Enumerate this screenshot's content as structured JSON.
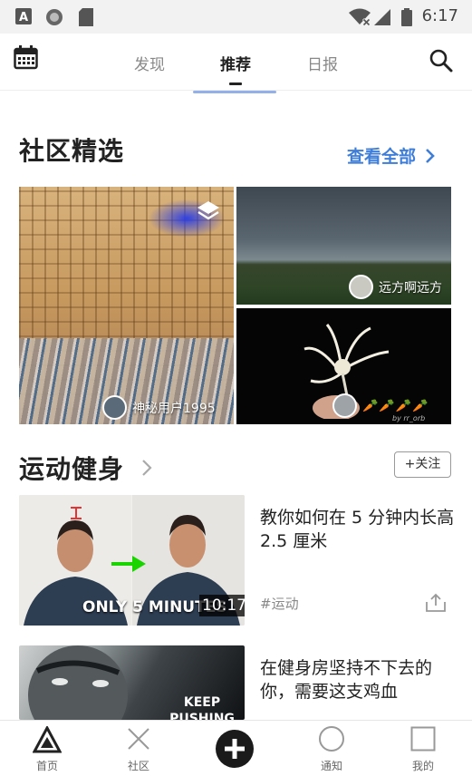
{
  "status_bar": {
    "time": "6:17",
    "icons": [
      "a-notification-icon",
      "circle-notification-icon",
      "sd-card-icon",
      "wifi-off-icon",
      "signal-icon",
      "battery-icon"
    ]
  },
  "top_nav": {
    "tabs": [
      {
        "label": "发现",
        "active": false
      },
      {
        "label": "推荐",
        "active": true
      },
      {
        "label": "日报",
        "active": false
      }
    ],
    "icons": [
      "calendar-icon",
      "search-icon"
    ]
  },
  "community": {
    "title": "社区精选",
    "see_all": "查看全部",
    "cards": [
      {
        "user": "神秘用户1995",
        "icon": "layers-icon"
      },
      {
        "user": "远方啊远方"
      },
      {
        "user": "",
        "watermark": "by rr_orb"
      }
    ]
  },
  "fitness": {
    "title": "运动健身",
    "follow": "+关注",
    "articles": [
      {
        "title": "教你如何在 5 分钟内长高 2.5 厘米",
        "tag": "#运动",
        "thumb_caption": "ONLY 5 MINUTES",
        "duration": "10:17"
      },
      {
        "title": "在健身房坚持不下去的你，需要这支鸡血",
        "thumb_caption": "KEEP PUSHING"
      }
    ]
  },
  "bottom_nav": {
    "items": [
      {
        "label": "首页",
        "icon": "home-triangle-icon"
      },
      {
        "label": "社区",
        "icon": "community-x-icon"
      },
      {
        "label": "",
        "icon": "add-circle-icon"
      },
      {
        "label": "通知",
        "icon": "notification-circle-icon"
      },
      {
        "label": "我的",
        "icon": "profile-square-icon"
      }
    ]
  },
  "colors": {
    "accent": "#3f7ed8",
    "text": "#222222",
    "muted": "#888888",
    "status_bar_bg": "#f2f2f2"
  }
}
